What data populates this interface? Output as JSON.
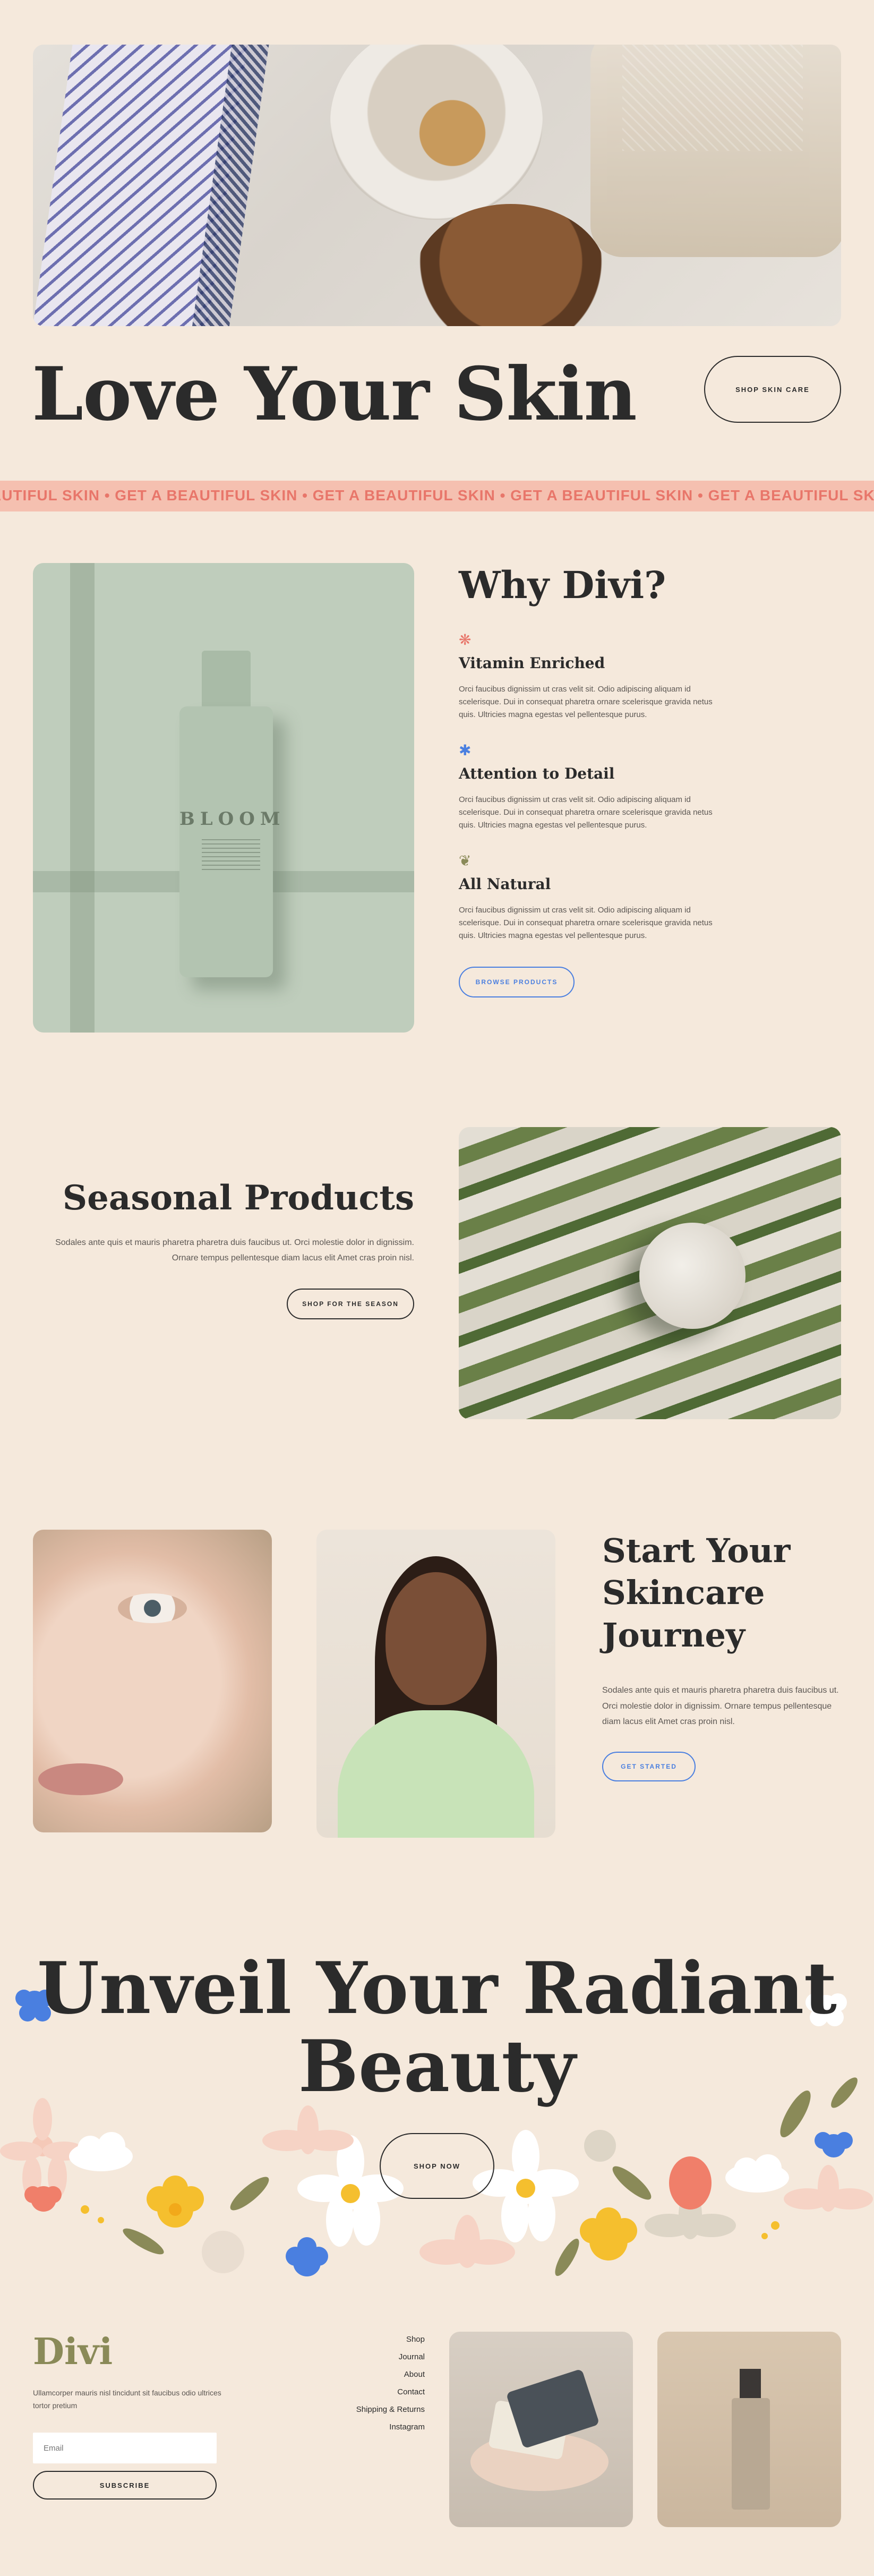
{
  "hero": {
    "title": "Love Your Skin",
    "button": "SHOP SKIN CARE"
  },
  "marquee": {
    "text": "AUTIFUL SKIN • GET A BEAUTIFUL SKIN • GET A BEAUTIFUL SKIN • GET A BEAUTIFUL SKIN • GET A BEAUTIFUL SKIN • GET A BEAUTIFUL SKIN • GET A"
  },
  "why": {
    "title": "Why Divi?",
    "product_brand": "BLOOM",
    "features": [
      {
        "icon": "flower-icon",
        "title": "Vitamin Enriched",
        "text": "Orci faucibus dignissim ut cras velit sit. Odio adipiscing aliquam id scelerisque. Dui in consequat pharetra ornare scelerisque gravida netus quis. Ultricies magna egestas vel pellentesque purus."
      },
      {
        "icon": "asterisk-icon",
        "title": "Attention to Detail",
        "text": "Orci faucibus dignissim ut cras velit sit. Odio adipiscing aliquam id scelerisque. Dui in consequat pharetra ornare scelerisque gravida netus quis. Ultricies magna egestas vel pellentesque purus."
      },
      {
        "icon": "leaf-icon",
        "title": "All Natural",
        "text": "Orci faucibus dignissim ut cras velit sit. Odio adipiscing aliquam id scelerisque. Dui in consequat pharetra ornare scelerisque gravida netus quis. Ultricies magna egestas vel pellentesque purus."
      }
    ],
    "button": "BROWSE PRODUCTS"
  },
  "seasonal": {
    "title": "Seasonal Products",
    "text": "Sodales ante quis et mauris pharetra pharetra duis faucibus ut. Orci molestie dolor in dignissim. Ornare tempus pellentesque diam lacus elit Amet cras proin nisl.",
    "button": "SHOP FOR THE SEASON"
  },
  "journey": {
    "title_line1": "Start Your",
    "title_line2": "Skincare",
    "title_line3": "Journey",
    "text": "Sodales ante quis et mauris pharetra pharetra duis faucibus ut. Orci molestie dolor in dignissim. Ornare tempus pellentesque diam lacus elit Amet cras proin nisl.",
    "button": "GET STARTED"
  },
  "radiant": {
    "title_line1": "Unveil Your Radiant",
    "title_line2": "Beauty",
    "button": "SHOP NOW"
  },
  "footer": {
    "logo": "Divi",
    "text": "Ullamcorper mauris nisl tincidunt sit faucibus odio ultrices tortor pretium",
    "email_placeholder": "Email",
    "subscribe": "SUBSCRIBE",
    "menu": [
      "Shop",
      "Journal",
      "About",
      "Contact",
      "Shipping & Returns",
      "Instagram"
    ]
  },
  "colors": {
    "background": "#f5e9dc",
    "text": "#2b2b2b",
    "accent_blue": "#4a7fe0",
    "accent_coral": "#e8766a",
    "marquee_bg": "#f5c0b0",
    "logo_olive": "#8a8a58"
  }
}
